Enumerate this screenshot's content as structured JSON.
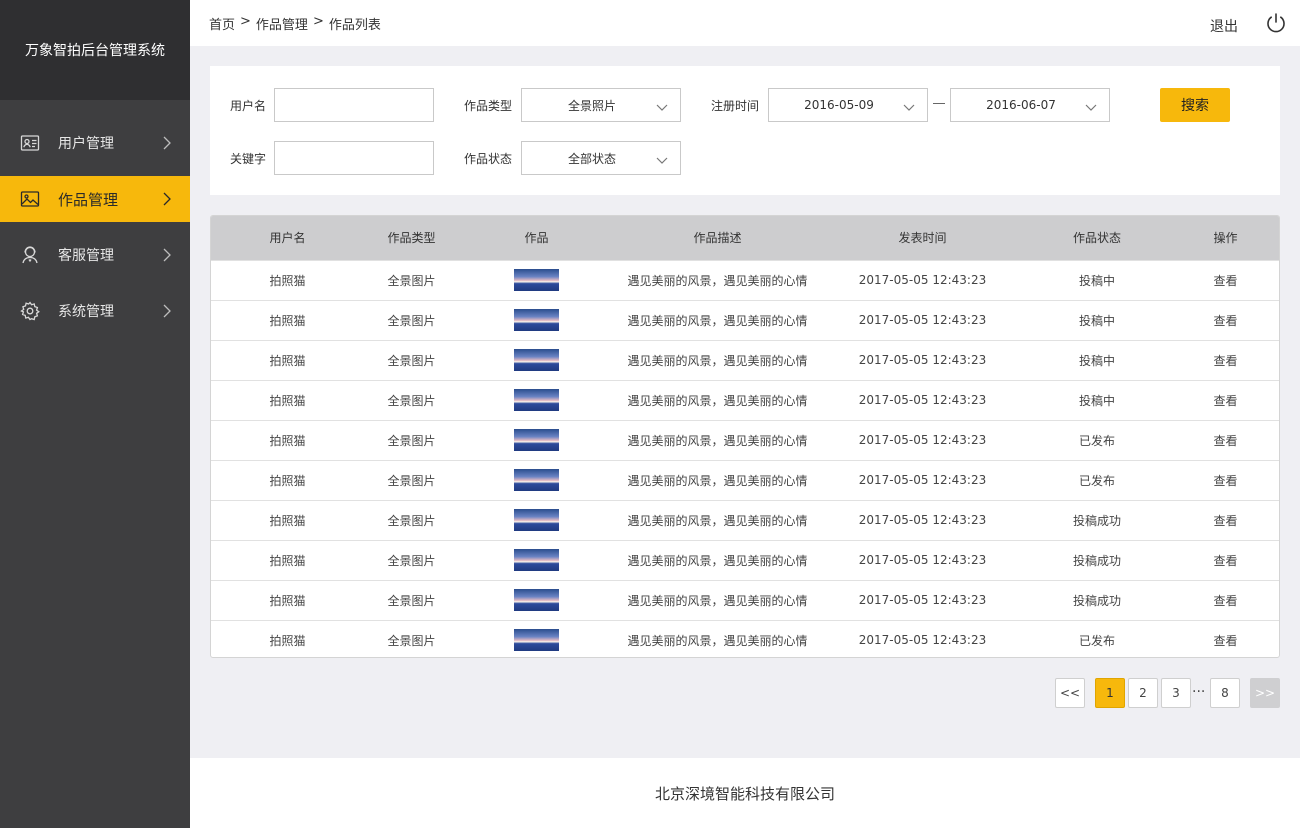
{
  "sidebar": {
    "brand": "万象智拍后台管理系统",
    "items": [
      {
        "label": "用户管理",
        "icon": "user-card-icon"
      },
      {
        "label": "作品管理",
        "icon": "image-icon",
        "active": true
      },
      {
        "label": "客服管理",
        "icon": "support-icon"
      },
      {
        "label": "系统管理",
        "icon": "gear-icon"
      }
    ]
  },
  "header": {
    "breadcrumb": [
      "首页",
      ">",
      "作品管理",
      ">",
      "作品列表"
    ],
    "logout": "退出"
  },
  "filters": {
    "username_label": "用户名",
    "type_label": "作品类型",
    "type_value": "全景照片",
    "regtime_label": "注册时间",
    "date_from": "2016-05-09",
    "date_to": "2016-06-07",
    "search_button": "搜索",
    "keyword_label": "关键字",
    "status_label": "作品状态",
    "status_value": "全部状态"
  },
  "table": {
    "headers": [
      "用户名",
      "作品类型",
      "作品",
      "作品描述",
      "发表时间",
      "作品状态",
      "操作"
    ],
    "rows": [
      [
        "拍照猫",
        "全景图片",
        "遇见美丽的风景，遇见美丽的心情",
        "2017-05-05   12:43:23",
        "投稿中",
        "查看"
      ],
      [
        "拍照猫",
        "全景图片",
        "遇见美丽的风景，遇见美丽的心情",
        "2017-05-05   12:43:23",
        "投稿中",
        "查看"
      ],
      [
        "拍照猫",
        "全景图片",
        "遇见美丽的风景，遇见美丽的心情",
        "2017-05-05   12:43:23",
        "投稿中",
        "查看"
      ],
      [
        "拍照猫",
        "全景图片",
        "遇见美丽的风景，遇见美丽的心情",
        "2017-05-05   12:43:23",
        "投稿中",
        "查看"
      ],
      [
        "拍照猫",
        "全景图片",
        "遇见美丽的风景，遇见美丽的心情",
        "2017-05-05   12:43:23",
        "已发布",
        "查看"
      ],
      [
        "拍照猫",
        "全景图片",
        "遇见美丽的风景，遇见美丽的心情",
        "2017-05-05   12:43:23",
        "已发布",
        "查看"
      ],
      [
        "拍照猫",
        "全景图片",
        "遇见美丽的风景，遇见美丽的心情",
        "2017-05-05   12:43:23",
        "投稿成功",
        "查看"
      ],
      [
        "拍照猫",
        "全景图片",
        "遇见美丽的风景，遇见美丽的心情",
        "2017-05-05   12:43:23",
        "投稿成功",
        "查看"
      ],
      [
        "拍照猫",
        "全景图片",
        "遇见美丽的风景，遇见美丽的心情",
        "2017-05-05   12:43:23",
        "投稿成功",
        "查看"
      ],
      [
        "拍照猫",
        "全景图片",
        "遇见美丽的风景，遇见美丽的心情",
        "2017-05-05   12:43:23",
        "已发布",
        "查看"
      ]
    ]
  },
  "pagination": {
    "prev": "<<",
    "pages": [
      "1",
      "2",
      "3"
    ],
    "ellipsis": "···",
    "last": "8",
    "next": ">>",
    "current": "1"
  },
  "footer": {
    "company": "北京深境智能科技有限公司"
  },
  "colors": {
    "accent": "#f7b80c",
    "sidebar_bg": "#3e3e40",
    "brand_bg": "#2f2f31"
  }
}
